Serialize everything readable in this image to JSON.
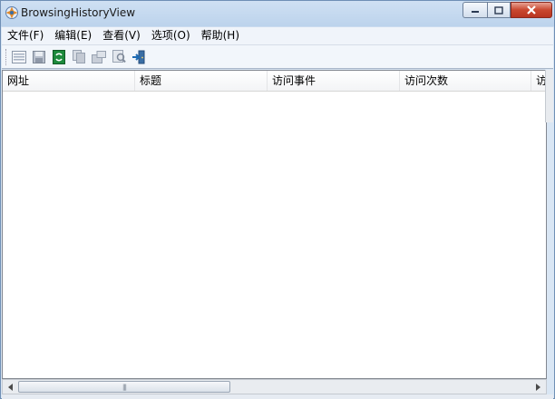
{
  "window": {
    "title": "BrowsingHistoryView"
  },
  "menu": [
    "文件(F)",
    "编辑(E)",
    "查看(V)",
    "选项(O)",
    "帮助(H)"
  ],
  "toolbar": [
    "html-report-icon",
    "save-icon",
    "refresh-icon",
    "copy-icon",
    "properties-icon",
    "find-icon",
    "exit-icon"
  ],
  "columns": [
    "网址",
    "标题",
    "访问事件",
    "访问次数",
    "访问"
  ],
  "scrollbar": {
    "grip": "|||"
  },
  "colors": {
    "close": "#c9472f",
    "accent": "#3a6ea5"
  }
}
